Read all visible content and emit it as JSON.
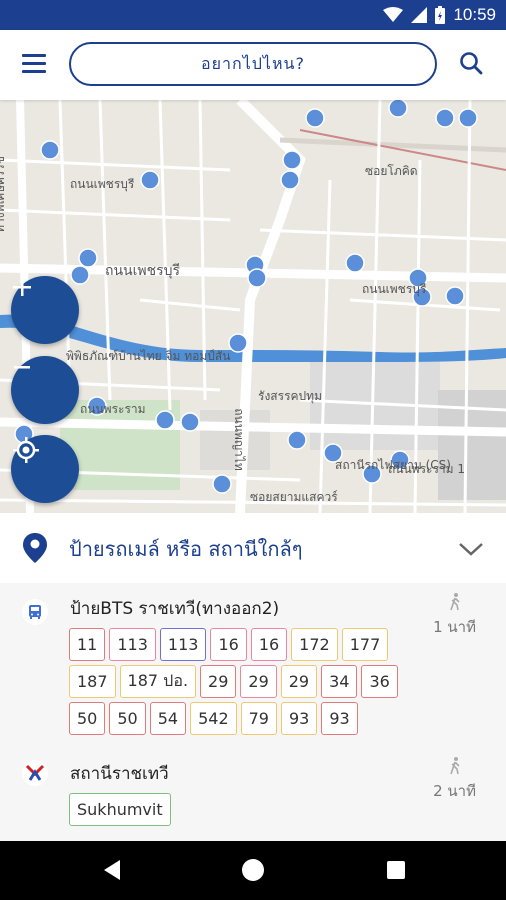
{
  "status_bar": {
    "time": "10:59"
  },
  "app_bar": {
    "search_placeholder": "อยากไปไหน?"
  },
  "map": {
    "labels": [
      "ถนนเพชรบุรี",
      "ถนนเพชรบุรี",
      "ถนนเพชรบุรี",
      "ซอยโภคิด",
      "รังสรรคปทุม",
      "พิพิธภัณฑ์บ้านไทย จิม ทอมป์สัน",
      "ถนนพระราม",
      "ถนนพระราม 1",
      "ซอยสยามแสควร์",
      "สถานีรถไฟสยาม (CS)",
      "ทางพิเศษศรีรัช",
      "ถนนพญาไท"
    ]
  },
  "sheet": {
    "title": "ป้ายรถเมล์ หรือ สถานีใกล้ๆ"
  },
  "stops": [
    {
      "name": "ป้ายBTS ราชเทวี(ทางออก2)",
      "walk": "1 นาที",
      "routes": [
        {
          "label": "11",
          "color": "red"
        },
        {
          "label": "113",
          "color": "pink"
        },
        {
          "label": "113",
          "color": "blue"
        },
        {
          "label": "16",
          "color": "pink"
        },
        {
          "label": "16",
          "color": "pink"
        },
        {
          "label": "172",
          "color": "yellow"
        },
        {
          "label": "177",
          "color": "yellow"
        },
        {
          "label": "187",
          "color": "yellow"
        },
        {
          "label": "187 ปอ.",
          "color": "yellow"
        },
        {
          "label": "29",
          "color": "red"
        },
        {
          "label": "29",
          "color": "pink"
        },
        {
          "label": "29",
          "color": "yellow"
        },
        {
          "label": "34",
          "color": "red"
        },
        {
          "label": "36",
          "color": "red"
        },
        {
          "label": "50",
          "color": "red"
        },
        {
          "label": "50",
          "color": "red"
        },
        {
          "label": "54",
          "color": "red"
        },
        {
          "label": "542",
          "color": "yellow"
        },
        {
          "label": "79",
          "color": "yellow"
        },
        {
          "label": "93",
          "color": "yellow"
        },
        {
          "label": "93",
          "color": "red"
        }
      ]
    },
    {
      "name": "สถานีราชเทวี",
      "walk": "2 นาที",
      "routes": [
        {
          "label": "Sukhumvit",
          "color": "green"
        }
      ]
    }
  ],
  "colors": {
    "primary": "#1c3f8f",
    "fab": "#1c4d95",
    "canal": "#4f90d8"
  }
}
